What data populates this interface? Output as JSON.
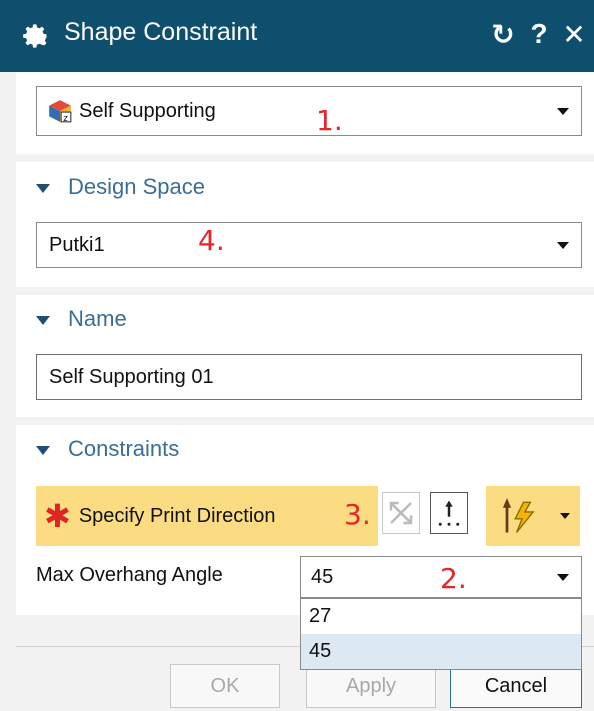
{
  "window": {
    "title": "Shape Constraint",
    "reset_glyph": "↻",
    "help_glyph": "?",
    "close_glyph": "✕"
  },
  "type_selector": {
    "value": "Self Supporting",
    "icon": "self-supporting-cube-icon",
    "annotation": "1."
  },
  "design_space": {
    "heading": "Design Space",
    "value": "Putki1",
    "annotation": "4."
  },
  "name_section": {
    "heading": "Name",
    "value": "Self Supporting 01"
  },
  "constraints": {
    "heading": "Constraints",
    "specify_print_direction": {
      "required_marker": "✱",
      "label": "Specify Print Direction",
      "annotation": "3."
    },
    "max_overhang": {
      "label": "Max Overhang Angle",
      "value": "45",
      "annotation": "2.",
      "options": [
        "27",
        "45"
      ],
      "highlighted_option": "45"
    }
  },
  "footer": {
    "ok_label": "OK",
    "apply_label": "Apply",
    "cancel_label": "Cancel"
  },
  "colors": {
    "titlebar": "#0e4f6e",
    "highlight": "#fbdc82",
    "section_heading": "#3a6e96",
    "annotation": "#e8232a",
    "required": "#e02424"
  }
}
